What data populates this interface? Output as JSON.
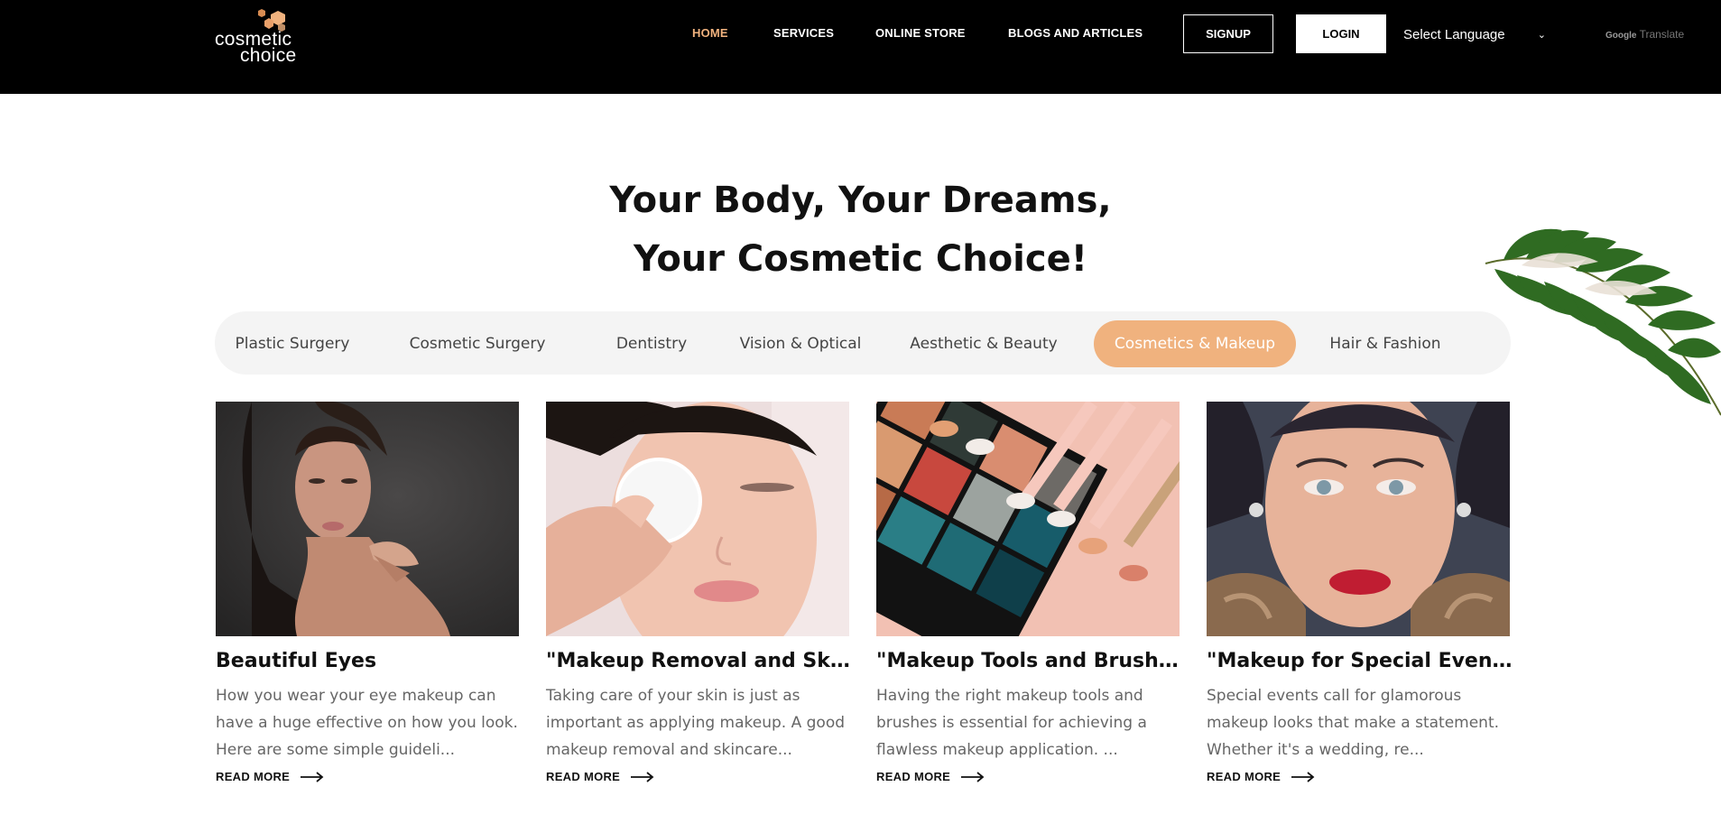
{
  "brand": {
    "logo_line1": "cosmetic",
    "logo_line2": "choice",
    "accent": "#f0b27e"
  },
  "nav": {
    "items": [
      {
        "label": "HOME",
        "active": true
      },
      {
        "label": "SERVICES"
      },
      {
        "label": "ONLINE STORE"
      },
      {
        "label": "BLOGS AND ARTICLES"
      }
    ],
    "signup": "SIGNUP",
    "login": "LOGIN",
    "language": "Select Language",
    "translate_brand": "Google",
    "translate_label": "Translate"
  },
  "hero": {
    "line1": "Your Body, Your Dreams,",
    "line2": "Your Cosmetic Choice!"
  },
  "tabs": [
    {
      "label": "Plastic Surgery"
    },
    {
      "label": "Cosmetic Surgery"
    },
    {
      "label": "Dentistry"
    },
    {
      "label": "Vision & Optical"
    },
    {
      "label": "Aesthetic & Beauty"
    },
    {
      "label": "Cosmetics & Makeup",
      "active": true
    },
    {
      "label": "Hair & Fashion"
    }
  ],
  "cards": [
    {
      "title": "Beautiful Eyes",
      "desc": "How you wear your eye makeup can have a huge effective on how you look. Here are some simple guideli...",
      "cta": "READ MORE",
      "image": "woman-dark-background"
    },
    {
      "title": "\"Makeup Removal and Skin...",
      "desc": "Taking care of your skin is just as important as applying makeup. A good makeup removal and skincare...",
      "cta": "READ MORE",
      "image": "woman-cotton-pad"
    },
    {
      "title": "\"Makeup Tools and Brushes:...",
      "desc": "Having the right makeup tools and brushes is essential for achieving a flawless makeup application. ...",
      "cta": "READ MORE",
      "image": "eyeshadow-palette-brushes"
    },
    {
      "title": "\"Makeup for Special Events:...",
      "desc": "Special events call for glamorous makeup looks that make a statement. Whether it's a wedding, re...",
      "cta": "READ MORE",
      "image": "woman-red-lips-fur"
    }
  ]
}
